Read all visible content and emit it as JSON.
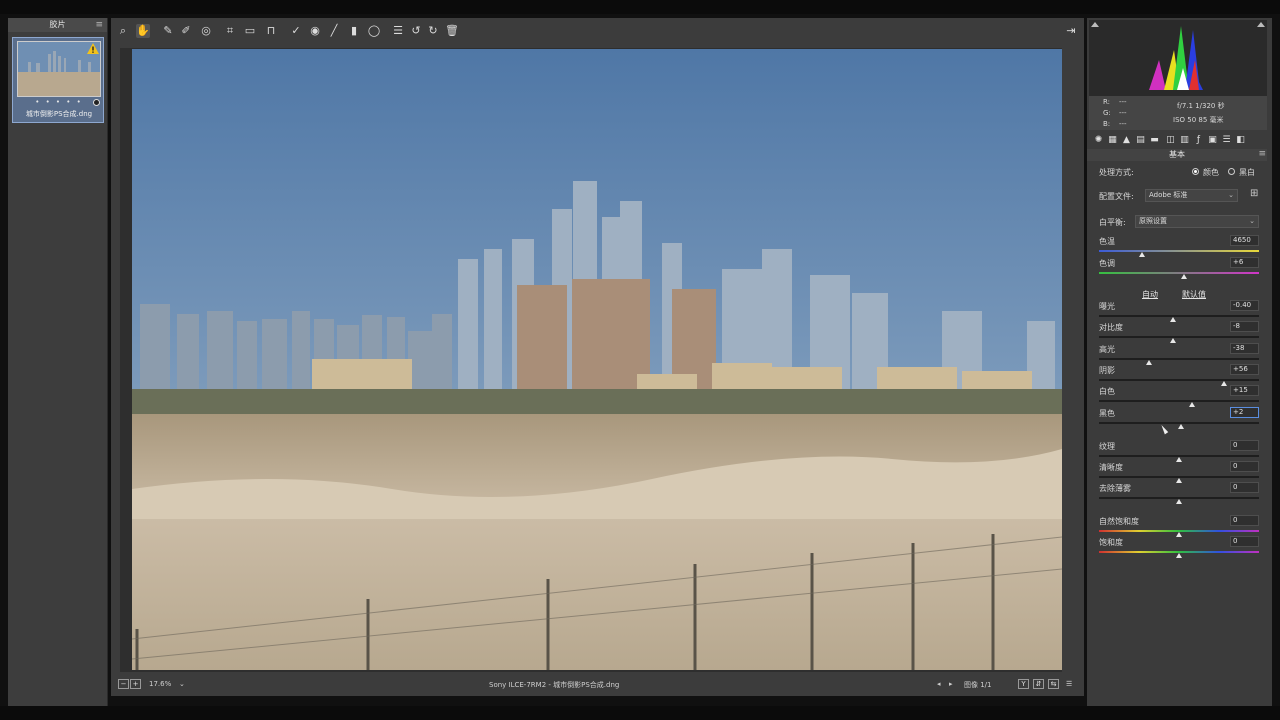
{
  "filmstrip": {
    "title": "胶片",
    "thumbnail_rating": "• • • • •",
    "thumbnail_name": "城市倒影PS合成.dng"
  },
  "statusbar": {
    "zoom": "17.6%",
    "file_info": "Sony ILCE-7RM2 - 城市倒影PS合成.dng",
    "image_count": "图像 1/1"
  },
  "camera_info": {
    "r_label": "R:",
    "g_label": "G:",
    "b_label": "B:",
    "r": "---",
    "g": "---",
    "b": "---",
    "aperture_shutter": "f/7.1  1/320 秒",
    "iso_focal": "ISO 50  85 毫米"
  },
  "panel": {
    "section": "基本",
    "process_label": "处理方式:",
    "process_color": "颜色",
    "process_bw": "黑白",
    "profile_label": "配置文件:",
    "profile_value": "Adobe 标准",
    "wb_label": "白平衡:",
    "wb_value": "原照设置",
    "auto": "自动",
    "default": "默认值"
  },
  "sliders": [
    {
      "label": "色温",
      "value": "4650",
      "pos": 0.27
    },
    {
      "label": "色调",
      "value": "+6",
      "pos": 0.53
    },
    {
      "label": "曝光",
      "value": "-0.40",
      "pos": 0.46
    },
    {
      "label": "对比度",
      "value": "-8",
      "pos": 0.46
    },
    {
      "label": "高光",
      "value": "-38",
      "pos": 0.31
    },
    {
      "label": "阴影",
      "value": "+56",
      "pos": 0.78
    },
    {
      "label": "白色",
      "value": "+15",
      "pos": 0.58
    },
    {
      "label": "黑色",
      "value": "+2",
      "pos": 0.51
    },
    {
      "label": "纹理",
      "value": "0",
      "pos": 0.5
    },
    {
      "label": "清晰度",
      "value": "0",
      "pos": 0.5
    },
    {
      "label": "去除薄雾",
      "value": "0",
      "pos": 0.5
    },
    {
      "label": "自然饱和度",
      "value": "0",
      "pos": 0.5
    },
    {
      "label": "饱和度",
      "value": "0",
      "pos": 0.5
    }
  ],
  "colors": {
    "accent_selected": "#5a6e8c",
    "value_highlight": "#2f6fd1"
  }
}
